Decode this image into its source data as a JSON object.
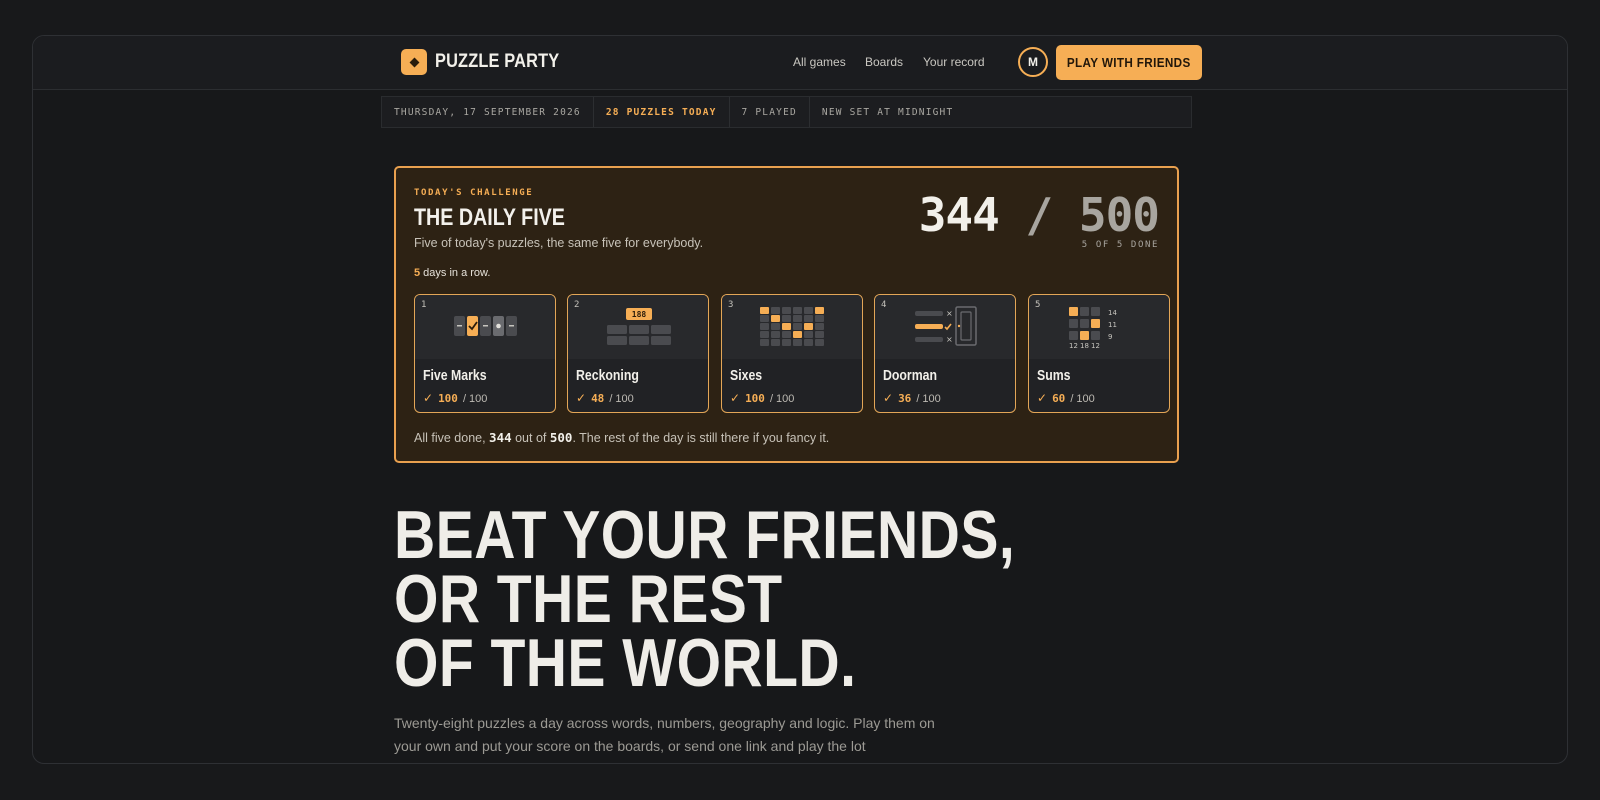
{
  "header": {
    "brand": "PUZZLE PARTY",
    "nav": [
      "All games",
      "Boards",
      "Your record"
    ],
    "avatar_initial": "M",
    "play_button": "PLAY WITH FRIENDS"
  },
  "status_strip": {
    "date": "THURSDAY, 17 SEPTEMBER 2026",
    "puzzles_today": "28 PUZZLES TODAY",
    "played": "7 PLAYED",
    "next_set": "NEW SET AT MIDNIGHT"
  },
  "challenge": {
    "eyebrow": "TODAY'S CHALLENGE",
    "title": "THE DAILY FIVE",
    "subtitle": "Five of today's puzzles, the same five for everybody.",
    "streak_count": "5",
    "streak_text": " days in a row.",
    "score_got": "344",
    "score_slash": " / ",
    "score_max": "500",
    "done_label": "5 OF 5 DONE",
    "tiles": [
      {
        "index": "1",
        "name": "Five Marks",
        "score": "100",
        "out_of": "/ 100",
        "check": "✓"
      },
      {
        "index": "2",
        "name": "Reckoning",
        "score": "48",
        "out_of": "/ 100",
        "check": "✓",
        "badge": "188"
      },
      {
        "index": "3",
        "name": "Sixes",
        "score": "100",
        "out_of": "/ 100",
        "check": "✓"
      },
      {
        "index": "4",
        "name": "Doorman",
        "score": "36",
        "out_of": "/ 100",
        "check": "✓"
      },
      {
        "index": "5",
        "name": "Sums",
        "score": "60",
        "out_of": "/ 100",
        "check": "✓",
        "row_sums": [
          "14",
          "11",
          "9"
        ],
        "col_sums": [
          "12",
          "18",
          "12"
        ]
      }
    ],
    "footer_pre": "All five done, ",
    "footer_got": "344",
    "footer_mid": " out of ",
    "footer_max": "500",
    "footer_post": ". The rest of the day is still there if you fancy it."
  },
  "hero": {
    "lines": [
      "BEAT YOUR FRIENDS,",
      "OR THE REST",
      "OF THE WORLD."
    ],
    "blurb": "Twenty-eight puzzles a day across words, numbers, geography and logic. Play them on your own and put your score on the boards, or send one link and play the lot"
  },
  "colors": {
    "accent": "#f6ae55",
    "background": "#18191b",
    "card_bg": "#2d2214"
  }
}
